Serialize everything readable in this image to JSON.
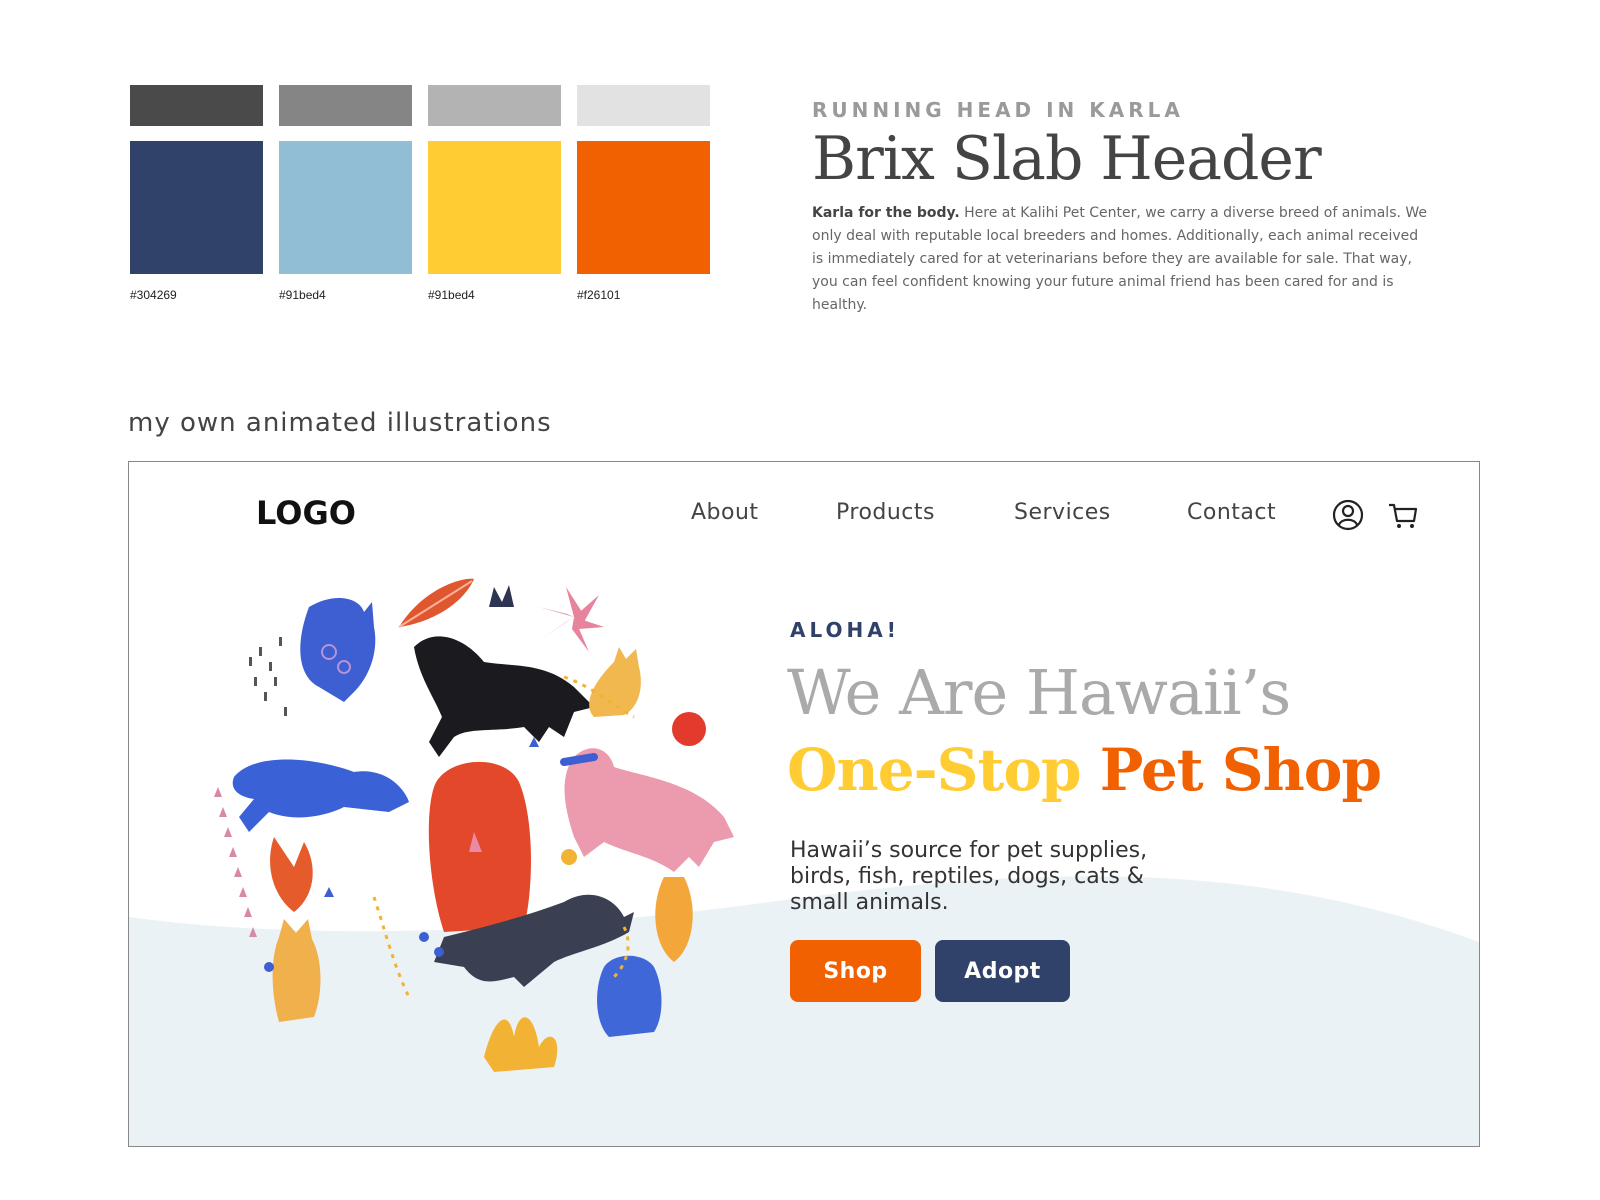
{
  "palette": {
    "neutrals": [
      "#4a4a4a",
      "#858585",
      "#b3b3b3",
      "#e2e2e2"
    ],
    "brand": [
      {
        "color": "#304269",
        "label": "#304269"
      },
      {
        "color": "#91bed4",
        "label": "#91bed4"
      },
      {
        "color": "#ffcc33",
        "label": "#91bed4"
      },
      {
        "color": "#f26101",
        "label": "#f26101"
      }
    ]
  },
  "typography": {
    "running_head": "RUNNING HEAD IN KARLA",
    "header": "Brix Slab Header",
    "body_bold": "Karla for the body.",
    "body_text": " Here at Kalihi Pet Center, we carry a diverse breed of animals. We only deal with  reputable local breeders and homes. Additionally, each animal received is immediately cared for at veterinarians before they are available for sale. That way, you can feel confident knowing your future animal friend has been cared for and is healthy."
  },
  "section_label": "my own animated illustrations",
  "mockup": {
    "logo": "LOGO",
    "nav": [
      "About",
      "Products",
      "Services",
      "Contact"
    ],
    "icons": [
      "user-icon",
      "cart-icon"
    ],
    "hero": {
      "kicker": "ALOHA!",
      "line1": "We Are Hawaii’s",
      "line2_part1": "One-Stop",
      "line2_part2": "Pet Shop",
      "subtitle": "Hawaii’s source for pet supplies, birds, fish, reptiles, dogs, cats & small animals.",
      "primary_button": "Shop",
      "secondary_button": "Adopt"
    },
    "colors": {
      "navy": "#304269",
      "yellow": "#ffcc33",
      "orange": "#f26101",
      "wave": "#ebf2f6"
    }
  }
}
